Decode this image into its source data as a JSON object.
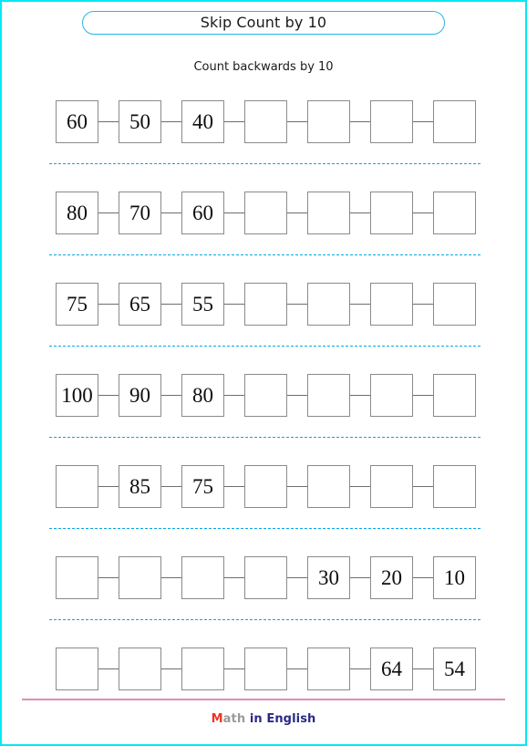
{
  "page": {
    "border_color": "#00eaf5",
    "background": "#ffffff"
  },
  "header": {
    "title": "Skip Count by 10",
    "title_border_color": "#2bb6e4",
    "subtitle": "Count backwards by 10"
  },
  "worksheet": {
    "boxes_per_row": 7,
    "divider_color": "#0aa6e8",
    "box_border_color": "#8a8a8a",
    "rows": [
      {
        "id": "row-1",
        "cells": [
          "60",
          "50",
          "40",
          "",
          "",
          "",
          ""
        ]
      },
      {
        "id": "row-2",
        "cells": [
          "80",
          "70",
          "60",
          "",
          "",
          "",
          ""
        ]
      },
      {
        "id": "row-3",
        "cells": [
          "75",
          "65",
          "55",
          "",
          "",
          "",
          ""
        ]
      },
      {
        "id": "row-4",
        "cells": [
          "100",
          "90",
          "80",
          "",
          "",
          "",
          ""
        ]
      },
      {
        "id": "row-5",
        "cells": [
          "",
          "85",
          "75",
          "",
          "",
          "",
          ""
        ]
      },
      {
        "id": "row-6",
        "cells": [
          "",
          "",
          "",
          "",
          "30",
          "20",
          "10"
        ]
      },
      {
        "id": "row-7",
        "cells": [
          "",
          "",
          "",
          "",
          "",
          "64",
          "54"
        ]
      }
    ]
  },
  "footer": {
    "rule_color": "#e28cb6",
    "logo": {
      "part1": "M",
      "part2": "ath",
      "part3": " in English",
      "part1_color": "#ef3124",
      "part2_color": "#9a9a9a",
      "part3_color": "#2a2a86"
    }
  }
}
